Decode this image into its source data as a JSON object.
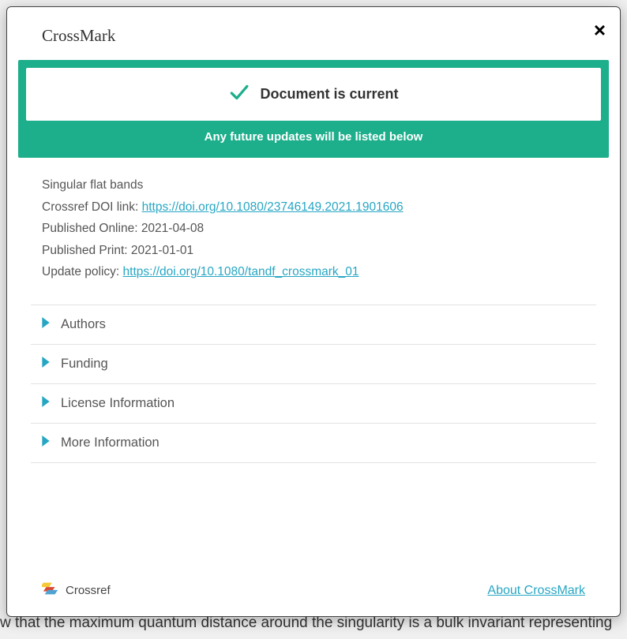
{
  "brand": "CrossMark",
  "close_label": "×",
  "status": {
    "main": "Document is current",
    "sub": "Any future updates will be listed below"
  },
  "meta": {
    "title": "Singular flat bands",
    "doi_label": "Crossref DOI link: ",
    "doi_url": "https://doi.org/10.1080/23746149.2021.1901606",
    "published_online_label": "Published Online: ",
    "published_online": "2021-04-08",
    "published_print_label": "Published Print: ",
    "published_print": "2021-01-01",
    "update_policy_label": "Update policy: ",
    "update_policy_url": "https://doi.org/10.1080/tandf_crossmark_01"
  },
  "accordion": [
    {
      "label": "Authors"
    },
    {
      "label": "Funding"
    },
    {
      "label": "License Information"
    },
    {
      "label": "More Information"
    }
  ],
  "footer": {
    "logo_label": "Crossref",
    "about_label": "About CrossMark"
  },
  "backdrop_bottom": "w that the maximum quantum distance around the singularity is a bulk invariant representing"
}
